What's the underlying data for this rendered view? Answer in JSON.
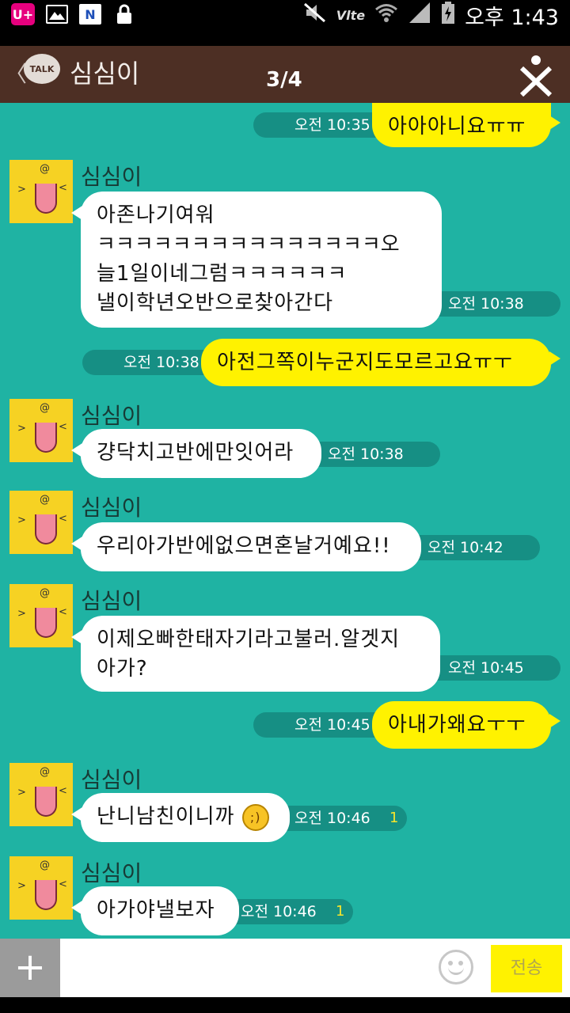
{
  "status_bar": {
    "carrier_icon": "U+",
    "gallery_icon": "image-icon",
    "news_icon": "N",
    "lock_icon": "lock-icon",
    "network": "Vlte",
    "time": "오후 1:43"
  },
  "header": {
    "back": "〈",
    "logo": "TALK",
    "title": "심심이",
    "pager": "3/4"
  },
  "messages": [
    {
      "kind": "out",
      "text": "아아아니요ㅠㅠ",
      "time": "오전 10:35"
    },
    {
      "kind": "in",
      "sender": "심심이",
      "lines": [
        "아존나기여워",
        "ㅋㅋㅋㅋㅋㅋㅋㅋㅋㅋㅋㅋㅋㅋㅋ오",
        "늘1일이네그럼ㅋㅋㅋㅋㅋㅋ",
        "낼이학년오반으로찾아간다"
      ],
      "time": "오전 10:38"
    },
    {
      "kind": "out",
      "text": "아전그쪽이누군지도모르고요ㅠㅜ",
      "time": "오전 10:38"
    },
    {
      "kind": "in",
      "sender": "심심이",
      "lines": [
        "걍닥치고반에만잇어라"
      ],
      "time": "오전 10:38"
    },
    {
      "kind": "in",
      "sender": "심심이",
      "lines": [
        "우리아가반에없으면혼날거예요!!"
      ],
      "time": "오전 10:42"
    },
    {
      "kind": "in",
      "sender": "심심이",
      "lines": [
        "이제오빠한태자기라고불러.알겟지",
        "아가?"
      ],
      "time": "오전 10:45"
    },
    {
      "kind": "out",
      "text": "아내가왜요ㅜㅜ",
      "time": "오전 10:45"
    },
    {
      "kind": "in",
      "sender": "심심이",
      "lines": [
        "난니남친이니까"
      ],
      "time": "오전 10:46",
      "read": "1",
      "emoji": "wink-emoji"
    },
    {
      "kind": "in",
      "sender": "심심이",
      "lines": [
        "아가야낼보자"
      ],
      "time": "오전 10:46",
      "read": "1"
    }
  ],
  "input": {
    "plus": "+",
    "placeholder": "",
    "send": "전송"
  },
  "colors": {
    "header_bg": "#4d2f24",
    "chat_bg": "#1fb3a3",
    "out_bubble": "#fff200",
    "in_bubble": "#ffffff",
    "time_pill": "#168f84"
  }
}
